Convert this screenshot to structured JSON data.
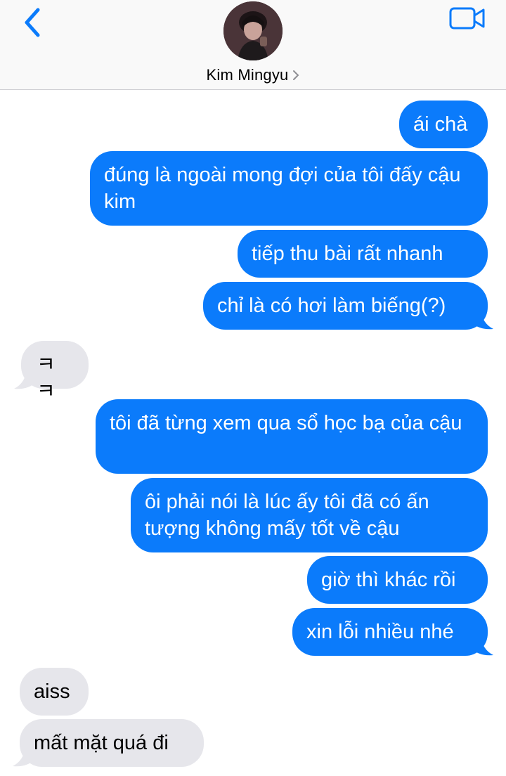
{
  "header": {
    "contact_name": "Kim Mingyu",
    "back_icon": "chevron-left-icon",
    "video_icon": "video-camera-icon",
    "accent_color": "#0b7bfb"
  },
  "messages": [
    {
      "from": "me",
      "text": "ái chà"
    },
    {
      "from": "me",
      "text": "đúng là ngoài mong đợi của tôi đấy cậu kim"
    },
    {
      "from": "me",
      "text": "tiếp thu bài rất nhanh"
    },
    {
      "from": "me",
      "text": "chỉ là có hơi làm biếng(?)"
    },
    {
      "from": "them",
      "text": "ㅋㅋ"
    },
    {
      "from": "me",
      "text": "tôi đã từng xem qua sổ học bạ của cậu"
    },
    {
      "from": "me",
      "text": "ôi phải nói là lúc ấy tôi đã có ấn tượng không mấy tốt về cậu"
    },
    {
      "from": "me",
      "text": "giờ thì khác rồi"
    },
    {
      "from": "me",
      "text": "xin lỗi nhiều nhé"
    },
    {
      "from": "them",
      "text": "aiss"
    },
    {
      "from": "them",
      "text": "mất mặt quá đi"
    }
  ],
  "colors": {
    "outgoing_bubble": "#0b7bfb",
    "incoming_bubble": "#e6e6eb"
  }
}
